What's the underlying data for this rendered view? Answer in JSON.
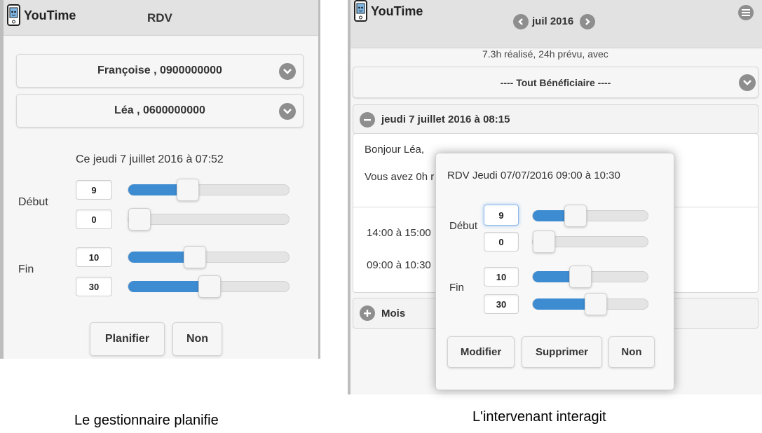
{
  "left": {
    "app_name": "YouTime",
    "header_title": "RDV",
    "select_1": "Françoise , 0900000000",
    "select_2": "Léa , 0600000000",
    "date_text": "Ce jeudi 7 juillet 2016 à 07:52",
    "start_label": "Début",
    "end_label": "Fin",
    "start_hour": "9",
    "start_minute": "0",
    "end_hour": "10",
    "end_minute": "30",
    "start_hour_fill": 0.37,
    "start_minute_fill": 0.0,
    "end_hour_fill": 0.41,
    "end_minute_fill": 0.5,
    "btn_plan": "Planifier",
    "btn_no": "Non"
  },
  "right": {
    "app_name": "YouTime",
    "month": "juil 2016",
    "summary": "7.3h réalisé, 24h prévu, avec",
    "beneficiary_select": "---- Tout Bénéficiaire ----",
    "section_title": "jeudi 7 juillet 2016 à 08:15",
    "greeting": "Bonjour Léa,",
    "message_partial": "Vous avez 0h r",
    "slot_1": "14:00 à 15:00",
    "slot_2": "09:00 à 10:30",
    "month_section": "Mois"
  },
  "popup": {
    "title": "RDV Jeudi 07/07/2016 09:00 à 10:30",
    "start_label": "Début",
    "end_label": "Fin",
    "start_hour": "9",
    "start_minute": "0",
    "end_hour": "10",
    "end_minute": "30",
    "start_hour_fill": 0.37,
    "start_minute_fill": 0.0,
    "end_hour_fill": 0.41,
    "end_minute_fill": 0.54,
    "btn_modify": "Modifier",
    "btn_delete": "Supprimer",
    "btn_no": "Non"
  },
  "captions": {
    "left": "Le gestionnaire planifie",
    "right": "L'intervenant interagit"
  },
  "colors": {
    "accent": "#3d8bd1",
    "header": "#e2e2e2",
    "icon_grey": "#8e8e8e"
  }
}
